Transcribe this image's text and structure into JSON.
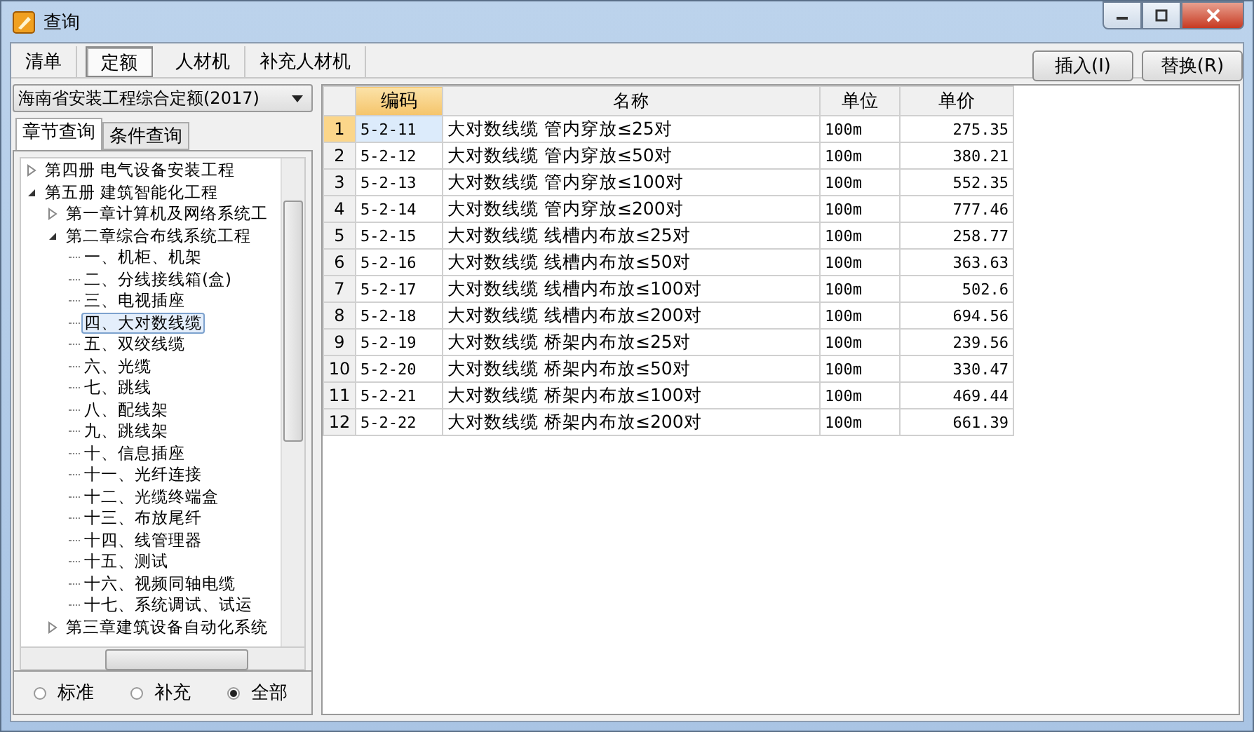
{
  "window": {
    "title": "查询"
  },
  "tabs": [
    {
      "label": "清单",
      "selected": false
    },
    {
      "label": "定额",
      "selected": true
    },
    {
      "label": "人材机",
      "selected": false
    },
    {
      "label": "补充人材机",
      "selected": false
    }
  ],
  "actions": [
    "插入(I)",
    "替换(R)"
  ],
  "library": {
    "value": "海南省安装工程综合定额(2017)"
  },
  "subtabs": [
    {
      "label": "章节查询",
      "selected": true
    },
    {
      "label": "条件查询",
      "selected": false
    }
  ],
  "tree": [
    {
      "label": "第四册 电气设备安装工程",
      "expanded": false,
      "selected": false
    },
    {
      "label": "第五册 建筑智能化工程",
      "expanded": true,
      "selected": false,
      "children": [
        {
          "label": "第一章计算机及网络系统工",
          "expanded": false,
          "selected": false
        },
        {
          "label": "第二章综合布线系统工程",
          "expanded": true,
          "selected": false,
          "children": [
            {
              "label": "一、机柜、机架",
              "selected": false
            },
            {
              "label": "二、分线接线箱(盒)",
              "selected": false
            },
            {
              "label": "三、电视插座",
              "selected": false
            },
            {
              "label": "四、大对数线缆",
              "selected": true
            },
            {
              "label": "五、双绞线缆",
              "selected": false
            },
            {
              "label": "六、光缆",
              "selected": false
            },
            {
              "label": "七、跳线",
              "selected": false
            },
            {
              "label": "八、配线架",
              "selected": false
            },
            {
              "label": "九、跳线架",
              "selected": false
            },
            {
              "label": "十、信息插座",
              "selected": false
            },
            {
              "label": "十一、光纤连接",
              "selected": false
            },
            {
              "label": "十二、光缆终端盒",
              "selected": false
            },
            {
              "label": "十三、布放尾纤",
              "selected": false
            },
            {
              "label": "十四、线管理器",
              "selected": false
            },
            {
              "label": "十五、测试",
              "selected": false
            },
            {
              "label": "十六、视频同轴电缆",
              "selected": false
            },
            {
              "label": "十七、系统调试、试运",
              "selected": false
            }
          ]
        },
        {
          "label": "第三章建筑设备自动化系统",
          "expanded": false,
          "selected": false
        }
      ]
    }
  ],
  "filter": [
    {
      "label": "标准",
      "selected": false
    },
    {
      "label": "补充",
      "selected": false
    },
    {
      "label": "全部",
      "selected": true
    }
  ],
  "table": {
    "columns": [
      {
        "label": "编码",
        "selected": true
      },
      {
        "label": "名称",
        "selected": false
      },
      {
        "label": "单位",
        "selected": false
      },
      {
        "label": "单价",
        "selected": false
      }
    ],
    "rows": [
      {
        "index": "1",
        "selected": true,
        "cells": [
          "5-2-11",
          "大对数线缆 管内穿放≤25对",
          "100m",
          "275.35"
        ]
      },
      {
        "index": "2",
        "selected": false,
        "cells": [
          "5-2-12",
          "大对数线缆 管内穿放≤50对",
          "100m",
          "380.21"
        ]
      },
      {
        "index": "3",
        "selected": false,
        "cells": [
          "5-2-13",
          "大对数线缆 管内穿放≤100对",
          "100m",
          "552.35"
        ]
      },
      {
        "index": "4",
        "selected": false,
        "cells": [
          "5-2-14",
          "大对数线缆 管内穿放≤200对",
          "100m",
          "777.46"
        ]
      },
      {
        "index": "5",
        "selected": false,
        "cells": [
          "5-2-15",
          "大对数线缆 线槽内布放≤25对",
          "100m",
          "258.77"
        ]
      },
      {
        "index": "6",
        "selected": false,
        "cells": [
          "5-2-16",
          "大对数线缆 线槽内布放≤50对",
          "100m",
          "363.63"
        ]
      },
      {
        "index": "7",
        "selected": false,
        "cells": [
          "5-2-17",
          "大对数线缆 线槽内布放≤100对",
          "100m",
          "502.6"
        ]
      },
      {
        "index": "8",
        "selected": false,
        "cells": [
          "5-2-18",
          "大对数线缆 线槽内布放≤200对",
          "100m",
          "694.56"
        ]
      },
      {
        "index": "9",
        "selected": false,
        "cells": [
          "5-2-19",
          "大对数线缆 桥架内布放≤25对",
          "100m",
          "239.56"
        ]
      },
      {
        "index": "10",
        "selected": false,
        "cells": [
          "5-2-20",
          "大对数线缆 桥架内布放≤50对",
          "100m",
          "330.47"
        ]
      },
      {
        "index": "11",
        "selected": false,
        "cells": [
          "5-2-21",
          "大对数线缆 桥架内布放≤100对",
          "100m",
          "469.44"
        ]
      },
      {
        "index": "12",
        "selected": false,
        "cells": [
          "5-2-22",
          "大对数线缆 桥架内布放≤200对",
          "100m",
          "661.39"
        ]
      }
    ]
  }
}
